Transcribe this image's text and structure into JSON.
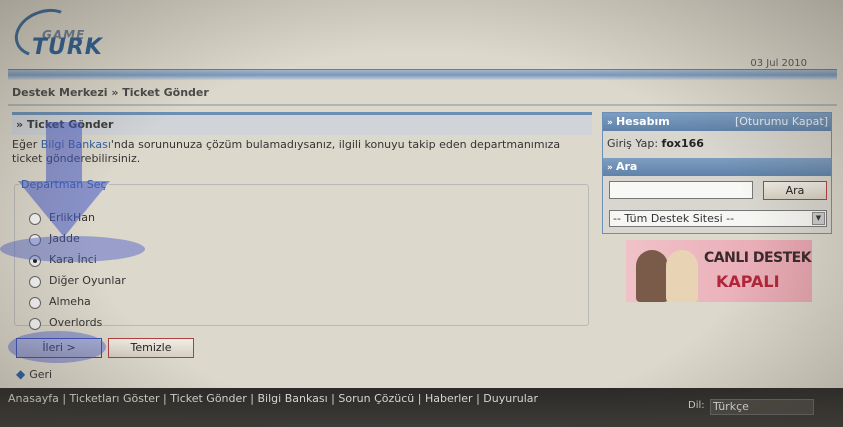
{
  "header": {
    "logo_game": "GAME",
    "logo_turk": "TURK",
    "date": "03 Jul 2010"
  },
  "breadcrumb": "Destek Merkezi » Ticket Gönder",
  "main": {
    "section_title": "Ticket Gönder",
    "intro_prefix": "Eğer ",
    "intro_link": "Bilgi Bankası",
    "intro_suffix": "'nda sorununuza çözüm bulamadıysanız, ilgili konuyu takip eden departmanımıza ticket gönderebilirsiniz.",
    "fieldset_legend": "Departman Seç",
    "departments": [
      {
        "label": "ErlikHan",
        "selected": false
      },
      {
        "label": "Jadde",
        "selected": false
      },
      {
        "label": "Kara İnci",
        "selected": true
      },
      {
        "label": "Diğer Oyunlar",
        "selected": false
      },
      {
        "label": "Almeha",
        "selected": false
      },
      {
        "label": "Overlords",
        "selected": false
      }
    ],
    "next_button": "İleri >",
    "reset_button": "Temizle",
    "back_link": "Geri"
  },
  "sidebar": {
    "account_title": "Hesabım",
    "logout": "[Oturumu Kapat]",
    "login_label": "Giriş Yap:",
    "login_user": "fox166",
    "search_title": "Ara",
    "search_value": "",
    "search_button": "Ara",
    "scope_select": "-- Tüm Destek Sitesi --"
  },
  "banner": {
    "line1": "CANLI DESTEK",
    "line2": "KAPALI"
  },
  "footer": {
    "links": [
      "Anasayfa",
      "Ticketları Göster",
      "Ticket Gönder",
      "Bilgi Bankası",
      "Sorun Çözücü",
      "Haberler",
      "Duyurular"
    ],
    "lang_label": "Dil:",
    "lang_value": "Türkçe"
  },
  "colors": {
    "accent": "#6b8fb6",
    "link": "#2d5fa5",
    "highlight": "#465ac8"
  }
}
